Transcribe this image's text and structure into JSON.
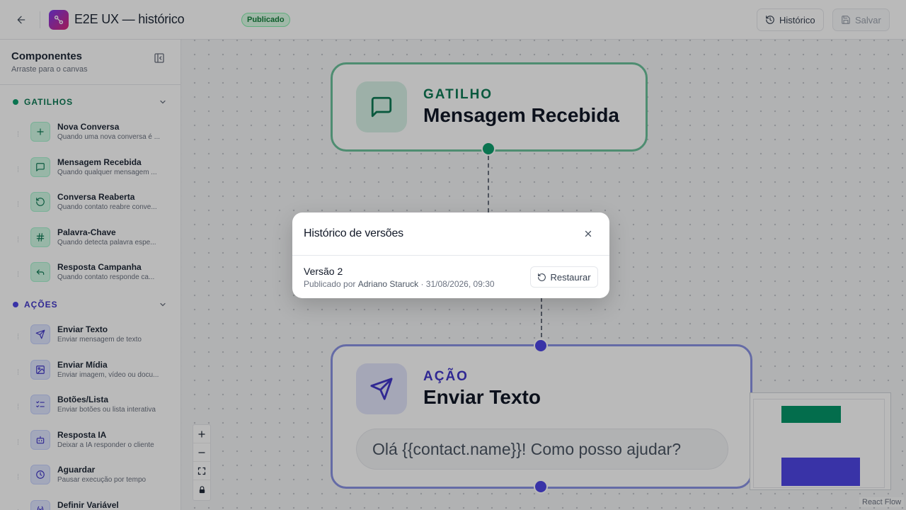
{
  "header": {
    "title": "E2E UX — histórico",
    "status": "Publicado",
    "history_label": "Histórico",
    "save_label": "Salvar"
  },
  "sidebar": {
    "title": "Componentes",
    "subtitle": "Arraste para o canvas",
    "sections": [
      {
        "label": "GATILHOS",
        "color": "#10b981",
        "items": [
          {
            "name": "Nova Conversa",
            "desc": "Quando uma nova conversa é ...",
            "icon": "plus-icon"
          },
          {
            "name": "Mensagem Recebida",
            "desc": "Quando qualquer mensagem ...",
            "icon": "message-square-icon"
          },
          {
            "name": "Conversa Reaberta",
            "desc": "Quando contato reabre conve...",
            "icon": "rotate-ccw-icon"
          },
          {
            "name": "Palavra-Chave",
            "desc": "Quando detecta palavra espe...",
            "icon": "hash-icon"
          },
          {
            "name": "Resposta Campanha",
            "desc": "Quando contato responde ca...",
            "icon": "reply-icon"
          }
        ]
      },
      {
        "label": "AÇÕES",
        "color": "#6366f1",
        "items": [
          {
            "name": "Enviar Texto",
            "desc": "Enviar mensagem de texto",
            "icon": "send-icon"
          },
          {
            "name": "Enviar Mídia",
            "desc": "Enviar imagem, vídeo ou docu...",
            "icon": "image-icon"
          },
          {
            "name": "Botões/Lista",
            "desc": "Enviar botões ou lista interativa",
            "icon": "list-checks-icon"
          },
          {
            "name": "Resposta IA",
            "desc": "Deixar a IA responder o cliente",
            "icon": "bot-icon"
          },
          {
            "name": "Aguardar",
            "desc": "Pausar execução por tempo",
            "icon": "clock-icon"
          },
          {
            "name": "Definir Variável",
            "desc": "",
            "icon": "variable-icon"
          }
        ]
      }
    ]
  },
  "canvas": {
    "trigger_node": {
      "type": "GATILHO",
      "name": "Mensagem Recebida"
    },
    "action_node": {
      "type": "AÇÃO",
      "name": "Enviar Texto",
      "message": "Olá {{contact.name}}! Como posso ajudar?"
    },
    "attribution": "React Flow"
  },
  "modal": {
    "title": "Histórico de versões",
    "version": {
      "name": "Versão 2",
      "published_prefix": "Publicado por",
      "author": "Adriano Staruck",
      "date": "· 31/08/2026, 09:30"
    },
    "restore_label": "Restaurar"
  },
  "colors": {
    "trigger": "#10b981",
    "action": "#6366f1",
    "status_badge": "#15803d"
  }
}
